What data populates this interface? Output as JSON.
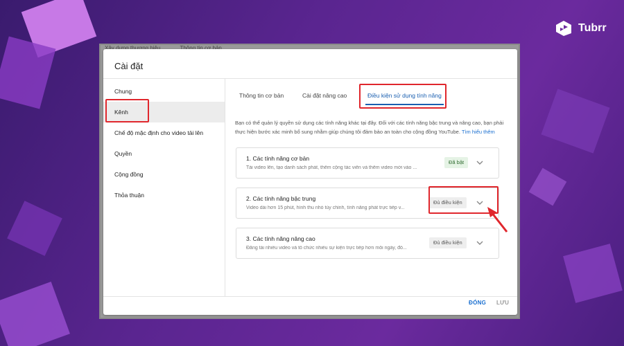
{
  "brand": {
    "name": "Tubrr"
  },
  "background_tabs": [
    "Xây dựng thương hiệu",
    "Thông tin cơ bản"
  ],
  "dialog": {
    "title": "Cài đặt",
    "sidebar": [
      "Chung",
      "Kênh",
      "Chế độ mặc định cho video tải lên",
      "Quyền",
      "Cộng đồng",
      "Thỏa thuận"
    ],
    "active_sidebar_item": "Kênh",
    "tabs": [
      "Thông tin cơ bản",
      "Cài đặt nâng cao",
      "Điều kiện sử dụng tính năng"
    ],
    "active_tab": "Điều kiện sử dụng tính năng",
    "intro": "Bạn có thể quản lý quyền sử dụng các tính năng khác tại đây. Đối với các tính năng bậc trung và nâng cao, bạn phải thực hiện bước xác minh bổ sung nhằm giúp chúng tôi đảm bảo an toàn cho cộng đồng YouTube.",
    "intro_link": "Tìm hiểu thêm",
    "features": [
      {
        "title": "1. Các tính năng cơ bản",
        "desc": "Tải video lên, tạo danh sách phát, thêm cộng tác viên và thêm video mới vào ...",
        "status": "Đã bật"
      },
      {
        "title": "2. Các tính năng bậc trung",
        "desc": "Video dài hơn 15 phút, hình thu nhỏ tùy chỉnh, tính năng phát trực tiếp v...",
        "status": "Đủ điều kiện"
      },
      {
        "title": "3. Các tính năng nâng cao",
        "desc": "Đăng tải nhiều video và tổ chức nhiều sự kiện trực tiếp hơn mỗi ngày, đồ...",
        "status": "Đủ điều kiện"
      }
    ],
    "footer": {
      "close": "ĐÓNG",
      "save": "LƯU"
    }
  },
  "colors": {
    "accent": "#1a5fb0",
    "highlight": "#e0262c",
    "enabled_badge": "#2f6b2f"
  }
}
